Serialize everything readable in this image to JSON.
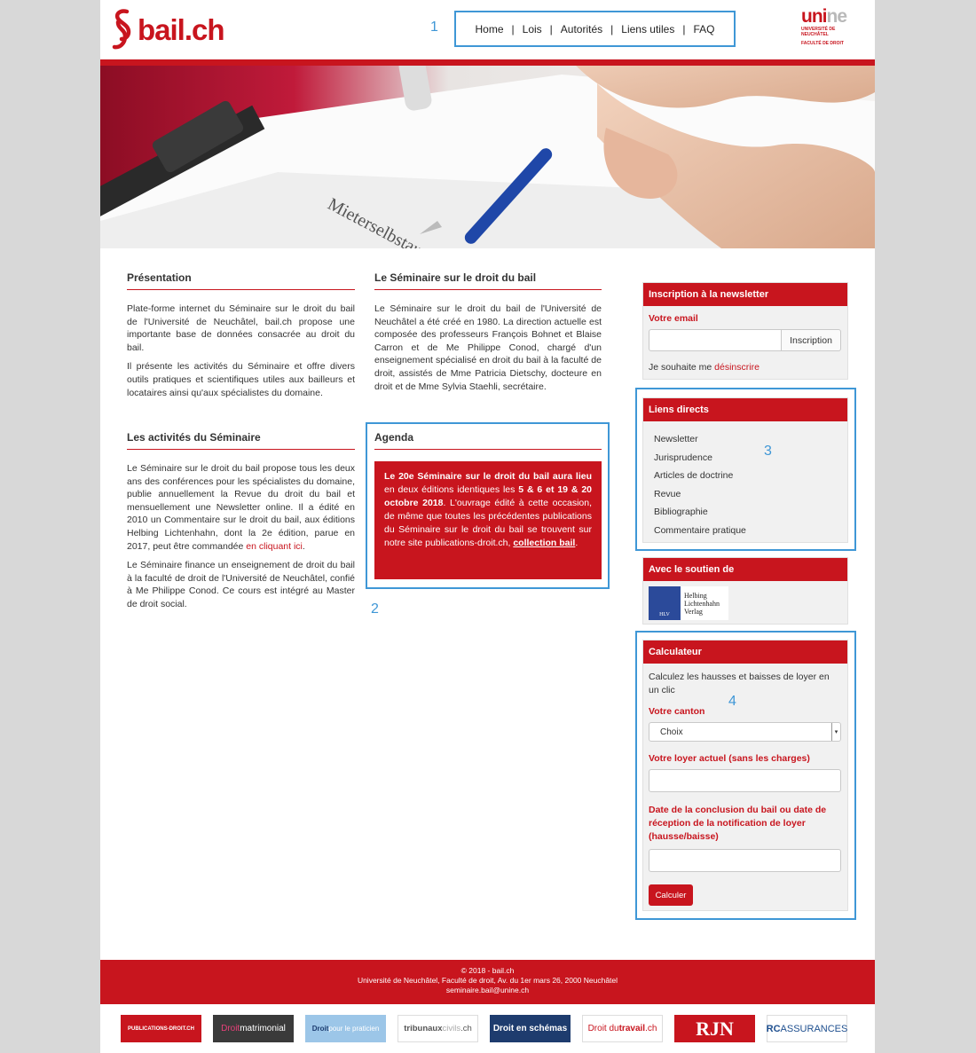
{
  "brand": {
    "logo_text": "bail.ch",
    "partner_logo": "unine",
    "partner_small1": "UNIVERSITÉ DE",
    "partner_small2": "NEUCHÂTEL",
    "partner_small3": "FACULTÉ DE DROIT"
  },
  "nav": {
    "items": [
      "Home",
      "Lois",
      "Autorités",
      "Liens utiles",
      "FAQ"
    ],
    "sep": "|"
  },
  "annotations": {
    "a1": "1",
    "a2": "2",
    "a3": "3",
    "a4": "4"
  },
  "presentation": {
    "title": "Présentation",
    "p1": "Plate-forme internet du Séminaire sur le droit du bail de l'Université de Neuchâtel, bail.ch propose une importante base de données consacrée au droit du bail.",
    "p2": "Il présente les activités du Séminaire et offre divers outils pratiques et scientifiques utiles aux bailleurs et locataires ainsi qu'aux spécialistes du domaine."
  },
  "activites": {
    "title": "Les activités du Séminaire",
    "p1": "Le Séminaire sur le droit du bail propose tous les deux ans des conférences pour les spécialistes du domaine, publie annuellement la Revue du droit du bail et mensuellement une Newsletter online. Il a édité en 2010 un Commentaire sur le droit du bail, aux éditions Helbing Lichtenhahn, dont la 2e édition, parue en 2017, peut être commandée",
    "p1_link": "en cliquant ici",
    "p1_end": ".",
    "p2": "Le Séminaire finance un enseignement de droit du bail à la faculté de droit de l'Université de Neuchâtel, confié à Me Philippe Conod. Ce cours est intégré au Master de droit social."
  },
  "seminaire": {
    "title": "Le Séminaire sur le droit du bail",
    "p1": "Le Séminaire sur le droit du bail de l'Université de Neuchâtel a été créé en 1980. La direction actuelle est composée des professeurs François Bohnet et Blaise Carron et de Me Philippe Conod, chargé d'un enseignement spécialisé en droit du bail à la faculté de droit, assistés de Mme Patricia Dietschy, docteure en droit et de Mme Sylvia Staehli, secrétaire."
  },
  "agenda": {
    "title": "Agenda",
    "bold": "Le 20e Séminaire sur le droit du bail aura lieu",
    "t1": " en deux éditions identiques les ",
    "bold2": "5 & 6 et 19 & 20 octobre 2018",
    "t2": ". L'ouvrage édité à cette occasion, de même que toutes les précédentes publications du Séminaire sur le droit du bail se trouvent sur notre site publications-droit.ch, ",
    "link": "collection bail",
    "t3": "."
  },
  "newsletter": {
    "title": "Inscription à la newsletter",
    "email_label": "Votre email",
    "email_value": "",
    "button": "Inscription",
    "unsub_text": "Je souhaite me ",
    "unsub_link": "désinscrire"
  },
  "liens": {
    "title": "Liens directs",
    "items": [
      "Newsletter",
      "Jurisprudence",
      "Articles de doctrine",
      "Revue",
      "Bibliographie",
      "Commentaire pratique"
    ]
  },
  "soutien": {
    "title": "Avec le soutien de",
    "publisher": [
      "Helbing",
      "Lichtenhahn",
      "Verlag"
    ],
    "publisher_abbr": "HLV"
  },
  "calc": {
    "title": "Calculateur",
    "intro": "Calculez les hausses et baisses de loyer en un clic",
    "canton_label": "Votre canton",
    "canton_value": "Choix",
    "loyer_label": "Votre loyer actuel (sans les charges)",
    "date_label": "Date de la conclusion du bail ou date de réception de la notification de loyer (hausse/baisse)",
    "button": "Calculer"
  },
  "footer": {
    "line1": "© 2018 - bail.ch",
    "line2": "Université de Neuchâtel, Faculté de droit, Av. du 1er mars 26, 2000 Neuchâtel",
    "line3": "seminaire.bail@unine.ch"
  },
  "partners": {
    "p1": "PUBLICATIONS-DROIT.CH",
    "p2a": "Droit",
    "p2b": "matrimonial",
    "p3a": "Droit",
    "p3b": " pour le praticien",
    "p4a": "tribunaux",
    "p4b": "civils",
    "p4c": ".ch",
    "p5": "Droit en schémas",
    "p6a": "Droit du ",
    "p6b": "travail",
    "p6c": ".ch",
    "p7": "RJN",
    "p8a": "RC",
    "p8b": "ASSURANCES"
  },
  "colors": {
    "brand_red": "#c8151e",
    "annotation_blue": "#3f97d6"
  }
}
